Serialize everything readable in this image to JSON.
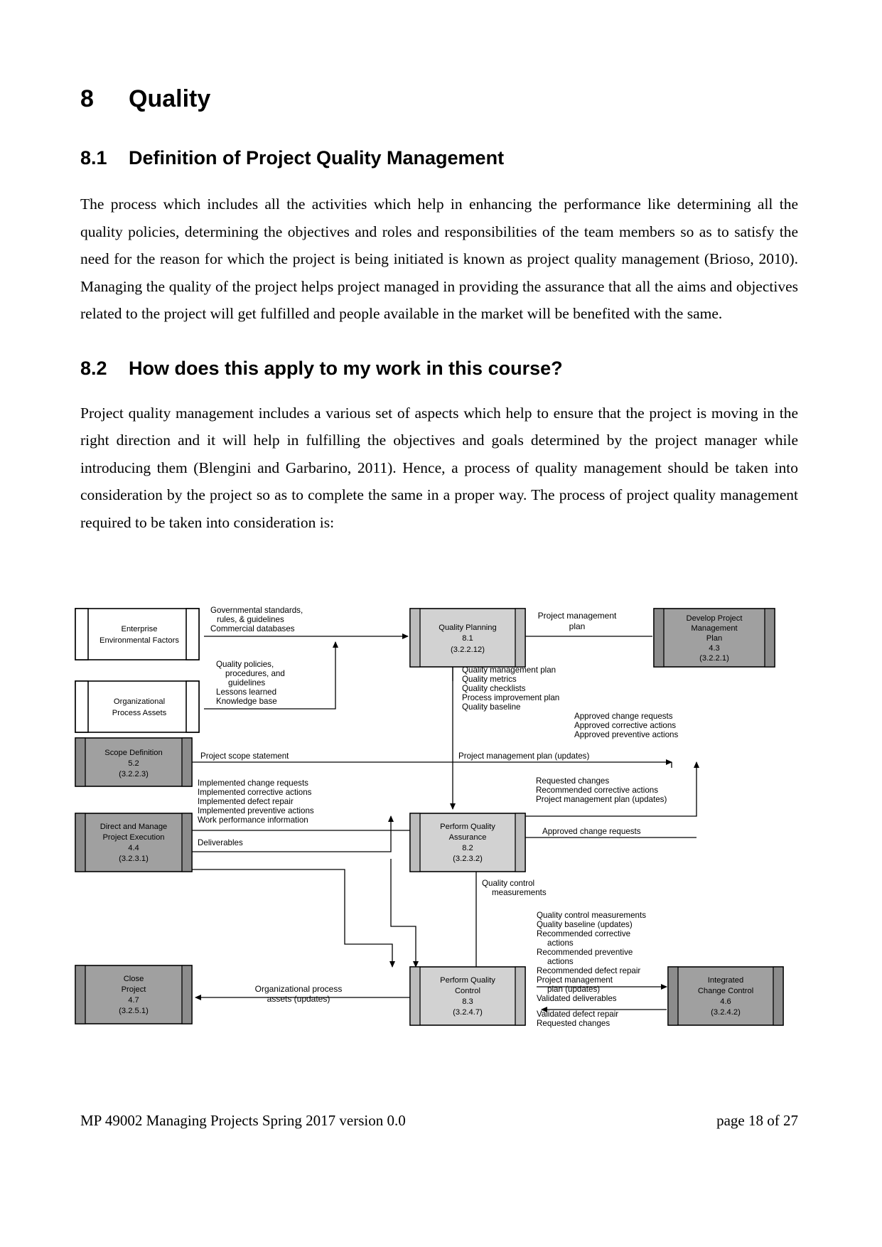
{
  "document": {
    "heading_1": {
      "number": "8",
      "title": "Quality"
    },
    "heading_2_1": {
      "number": "8.1",
      "title": "Definition of Project Quality Management"
    },
    "paragraph_1": "The process which includes all the activities which help in enhancing the performance like determining all the quality policies, determining the objectives and roles and responsibilities of the team members so as to satisfy the need for the reason for which the project is being initiated is known as project quality management (Brioso, 2010). Managing the quality of the project helps project managed in providing the assurance that all the aims and objectives related to the project will get fulfilled and people available in the market will be benefited with the same.",
    "heading_2_2": {
      "number": "8.2",
      "title": "How does this apply to my work in this course?"
    },
    "paragraph_2": "Project quality management includes a various set of aspects which help to ensure that the project is moving in the right direction and it will help in fulfilling the objectives and goals determined by the project manager while introducing them (Blengini and Garbarino, 2011). Hence, a process of quality management should be taken into consideration by the project so as to complete the same in a proper way. The process of project quality management required to be taken into consideration is:"
  },
  "footer": {
    "left": "MP 49002 Managing Projects Spring 2017   version 0.0",
    "right": "page 18 of 27"
  },
  "diagram": {
    "colors": {
      "light_gray": "#d2d2d2",
      "dark_gray": "#a0a0a0",
      "side_bar_light": "#bcbcbc",
      "side_bar_dark": "#8c8c8c",
      "white": "#ffffff",
      "stroke": "#000000"
    },
    "nodes": [
      {
        "id": "enterprise-environmental-factors",
        "type": "data-store",
        "lines": [
          "Enterprise",
          "Environmental Factors"
        ]
      },
      {
        "id": "organizational-process-assets",
        "type": "data-store",
        "lines": [
          "Organizational",
          "Process Assets"
        ]
      },
      {
        "id": "scope-definition",
        "type": "process-dark",
        "lines": [
          "Scope Definition",
          "5.2",
          "(3.2.2.3)"
        ]
      },
      {
        "id": "direct-and-manage-project-execution",
        "type": "process-dark",
        "lines": [
          "Direct and Manage",
          "Project Execution",
          "4.4",
          "(3.2.3.1)"
        ]
      },
      {
        "id": "close-project",
        "type": "process-dark",
        "lines": [
          "Close",
          "Project",
          "4.7",
          "(3.2.5.1)"
        ]
      },
      {
        "id": "quality-planning",
        "type": "process-light",
        "lines": [
          "Quality Planning",
          "8.1",
          "(3.2.2.12)"
        ]
      },
      {
        "id": "perform-quality-assurance",
        "type": "process-light",
        "lines": [
          "Perform Quality",
          "Assurance",
          "8.2",
          "(3.2.3.2)"
        ]
      },
      {
        "id": "perform-quality-control",
        "type": "process-light",
        "lines": [
          "Perform Quality",
          "Control",
          "8.3",
          "(3.2.4.7)"
        ]
      },
      {
        "id": "develop-project-management-plan",
        "type": "process-dark",
        "lines": [
          "Develop Project",
          "Management",
          "Plan",
          "4.3",
          "(3.2.2.1)"
        ]
      },
      {
        "id": "integrated-change-control",
        "type": "process-dark",
        "lines": [
          "Integrated",
          "Change Control",
          "4.6",
          "(3.2.4.2)"
        ]
      }
    ],
    "flows": [
      {
        "id": "governmental-standards",
        "lines": [
          "Governmental standards,",
          "rules, & guidelines",
          "Commercial databases"
        ]
      },
      {
        "id": "quality-policies",
        "lines": [
          "Quality policies,",
          "procedures, and",
          "guidelines",
          "Lessons learned",
          "Knowledge base"
        ]
      },
      {
        "id": "project-scope-statement",
        "lines": [
          "Project scope statement"
        ]
      },
      {
        "id": "project-management-plan",
        "lines": [
          "Project management",
          "plan"
        ]
      },
      {
        "id": "quality-planning-outputs",
        "lines": [
          "Quality management plan",
          "Quality metrics",
          "Quality checklists",
          "Process improvement plan",
          "Quality baseline"
        ]
      },
      {
        "id": "approved-requests",
        "lines": [
          "Approved change requests",
          "Approved corrective actions",
          "Approved preventive actions"
        ]
      },
      {
        "id": "project-management-plan-updates",
        "lines": [
          "Project management plan (updates)"
        ]
      },
      {
        "id": "implemented-items",
        "lines": [
          "Implemented change requests",
          "Implemented corrective actions",
          "Implemented defect repair",
          "Implemented preventive actions",
          "Work performance information"
        ]
      },
      {
        "id": "deliverables",
        "lines": [
          "Deliverables"
        ]
      },
      {
        "id": "qa-outputs",
        "lines": [
          "Requested changes",
          "Recommended corrective actions",
          "Project management plan (updates)"
        ]
      },
      {
        "id": "approved-change-requests-qa",
        "lines": [
          "Approved change requests"
        ]
      },
      {
        "id": "quality-control-measurements-up",
        "lines": [
          "Quality control",
          "measurements"
        ]
      },
      {
        "id": "qc-outputs",
        "lines": [
          "Quality control measurements",
          "Quality baseline (updates)",
          "Recommended corrective",
          "actions",
          "Recommended preventive",
          "actions",
          "Recommended defect repair",
          "Project management",
          "plan (updates)",
          "Validated deliverables"
        ]
      },
      {
        "id": "organizational-process-assets-updates",
        "lines": [
          "Organizational process",
          "assets (updates)"
        ]
      },
      {
        "id": "validated-defect-repair",
        "lines": [
          "Validated defect repair",
          "Requested changes"
        ]
      }
    ]
  }
}
